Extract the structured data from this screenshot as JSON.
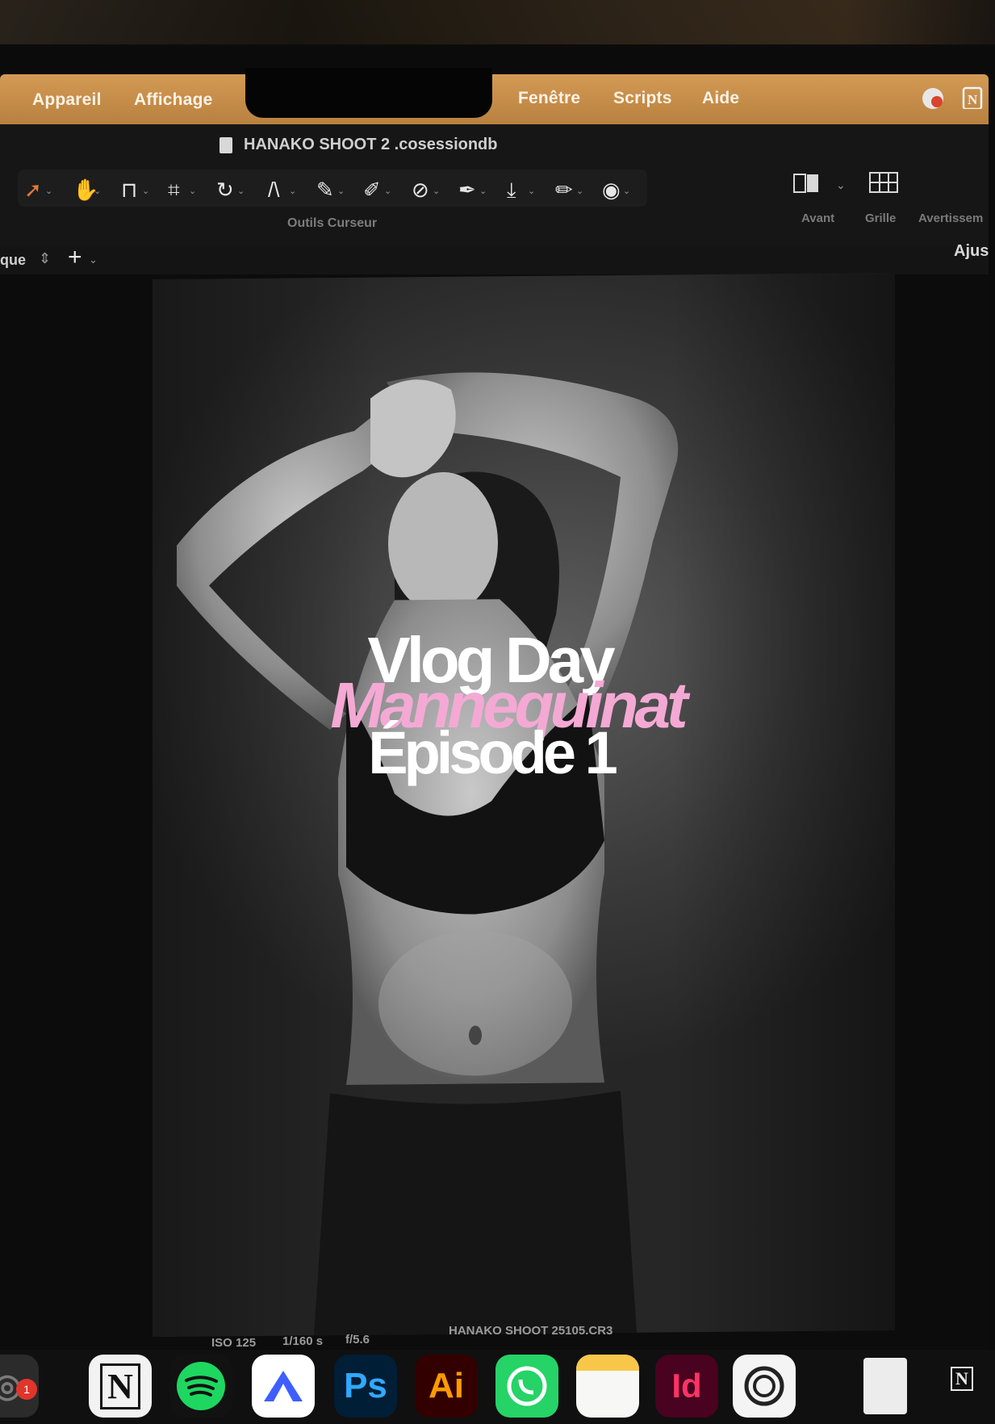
{
  "menubar": {
    "items_left": [
      "Appareil",
      "Affichage"
    ],
    "items_right": [
      "Fenêtre",
      "Scripts",
      "Aide"
    ]
  },
  "document": {
    "title": "HANAKO SHOOT 2 .cosessiondb"
  },
  "toolbar": {
    "tools_label": "Outils Curseur",
    "right_labels": [
      "Avant",
      "Grille",
      "Avertissem"
    ],
    "ajust_label": "Ajus",
    "left_partial": "que"
  },
  "overlay": {
    "line1": "Vlog Day",
    "line2": "Mannequinat",
    "line3": "Épisode 1",
    "accent_color": "#f4a9d4"
  },
  "image_meta": {
    "iso": "ISO 125",
    "shutter": "1/160 s",
    "aperture": "f/5.6",
    "filename": "HANAKO SHOOT 25105.CR3"
  },
  "dock": {
    "apps": [
      "finder",
      "notion",
      "spotify",
      "nordvpn",
      "photoshop",
      "illustrator",
      "whatsapp",
      "notes",
      "indesign",
      "capture-one",
      "documents"
    ],
    "badge_count": "1",
    "labels": {
      "ps": "Ps",
      "ai": "Ai",
      "id": "Id",
      "notion": "N"
    }
  },
  "colors": {
    "menubar": "#c88c48",
    "accent_pink": "#f4a9d4",
    "tool_active": "#e07a3a"
  }
}
